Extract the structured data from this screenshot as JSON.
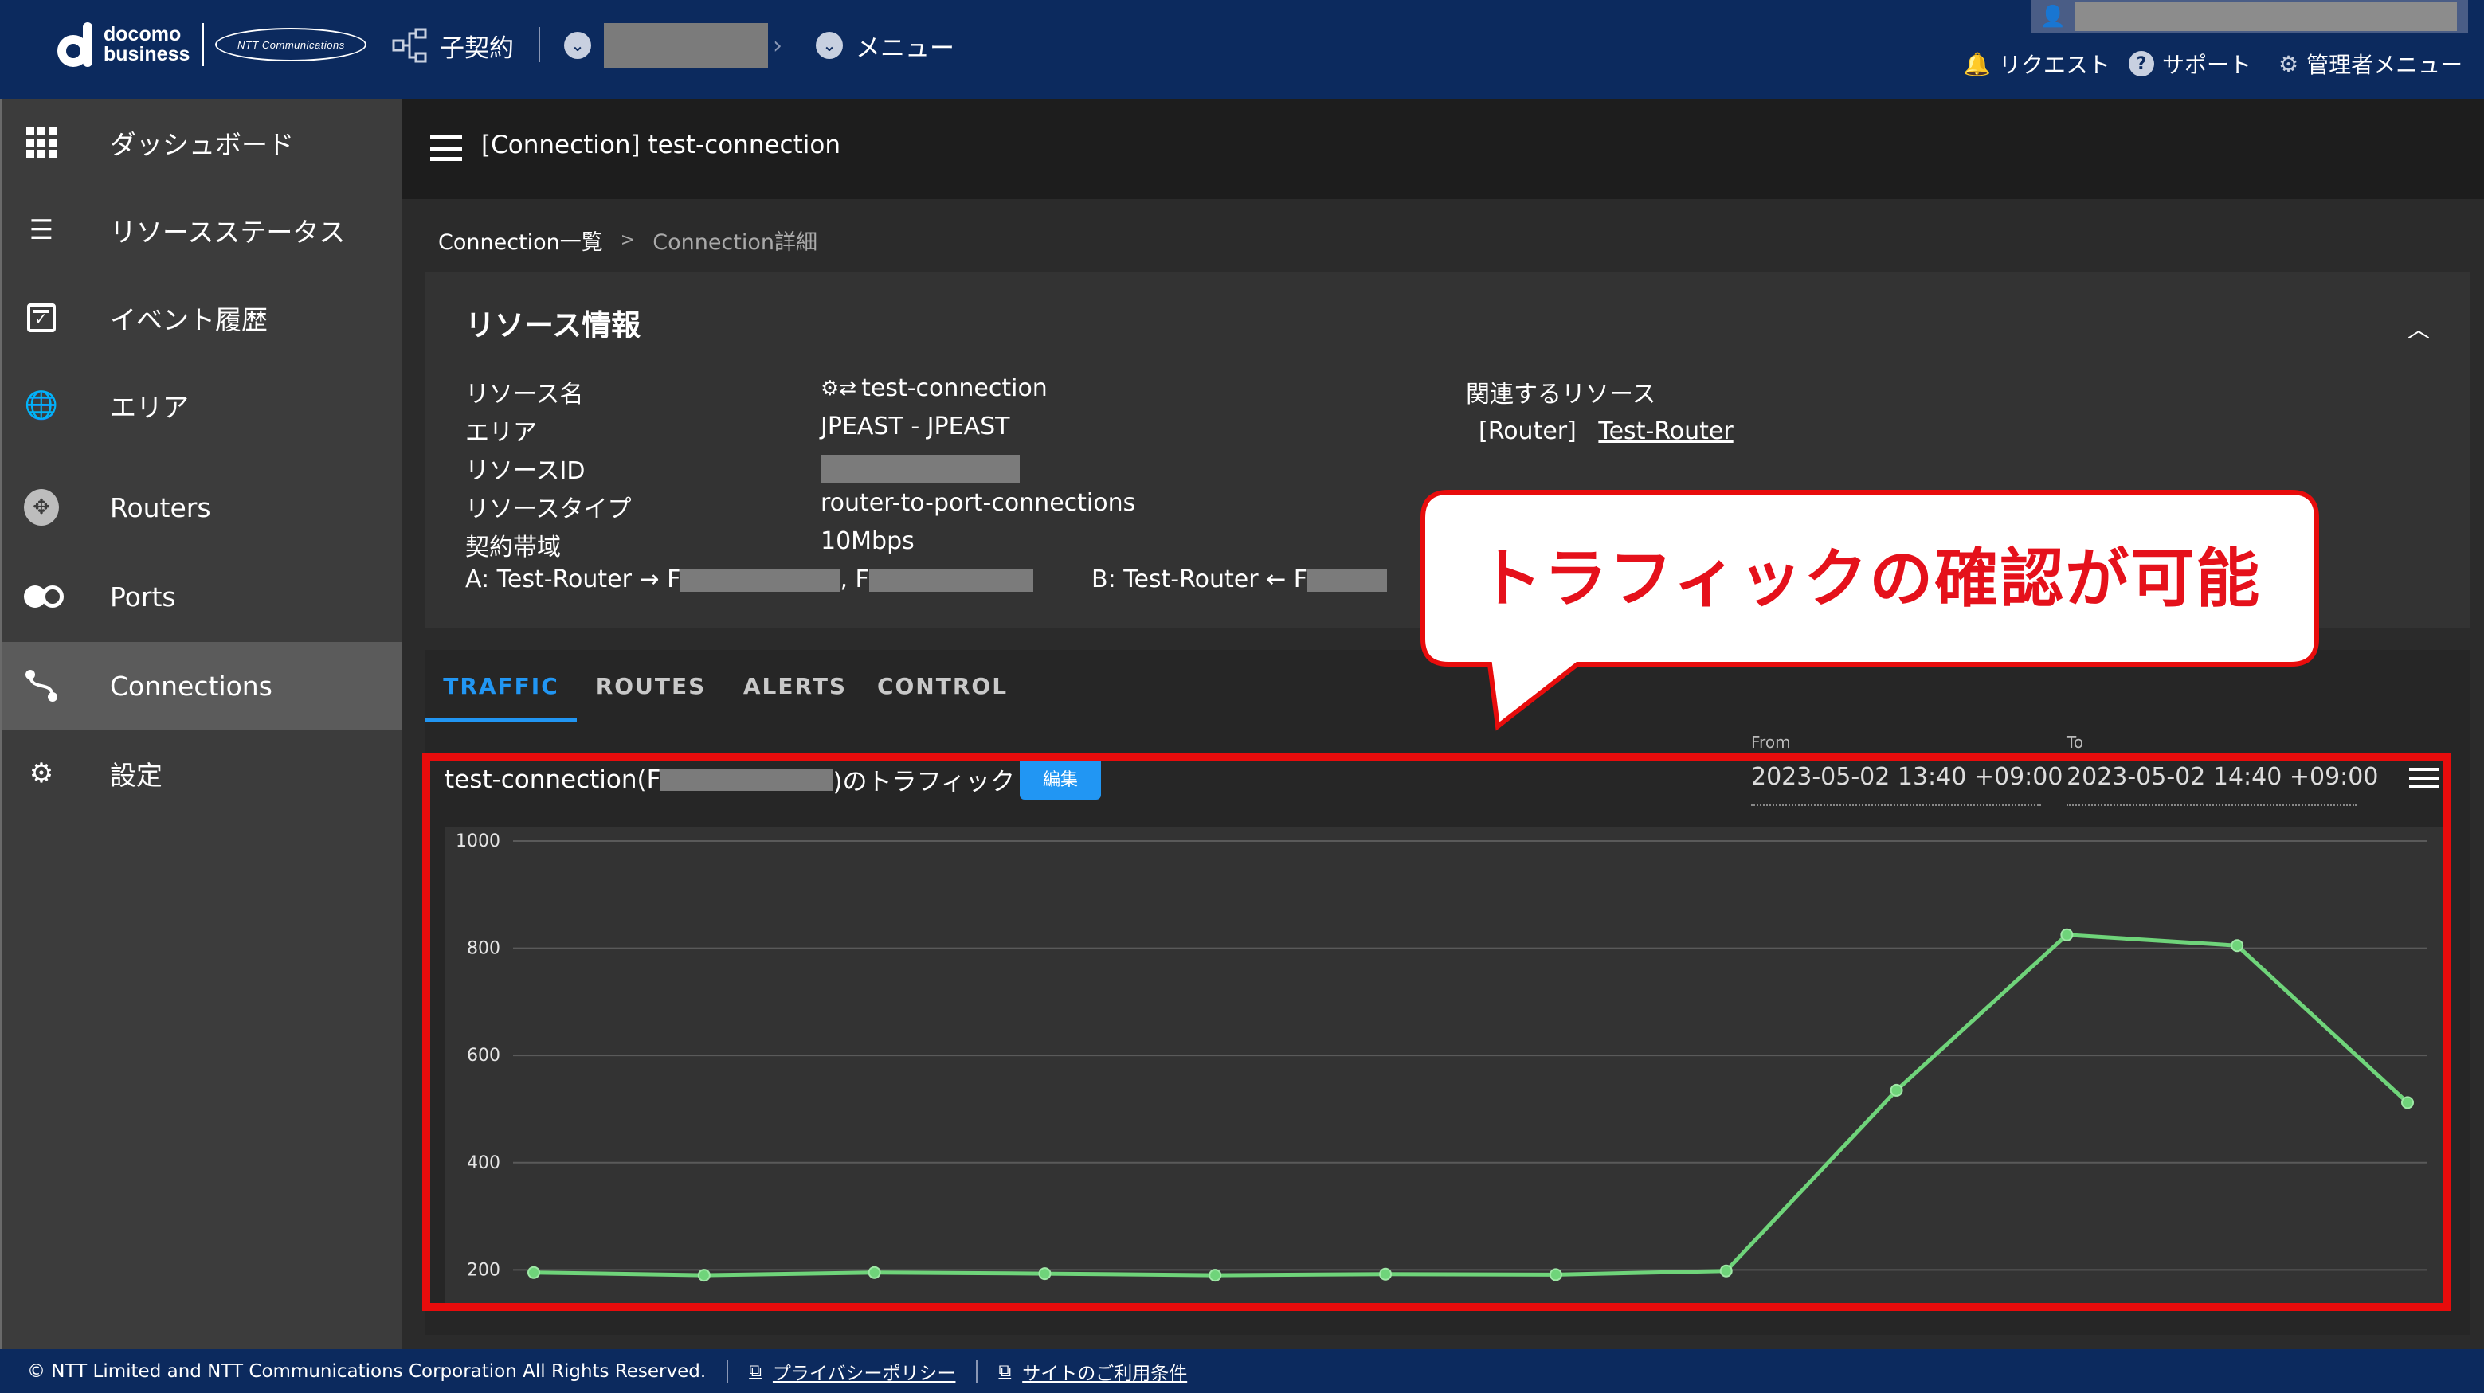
{
  "header": {
    "logo_line1": "docomo",
    "logo_line2": "business",
    "ntt_logo": "NTT Communications",
    "sub_contract": "子契約",
    "menu": "メニュー",
    "nav": {
      "request": "リクエスト",
      "support": "サポート",
      "admin_menu": "管理者メニュー"
    }
  },
  "sidebar": {
    "items": [
      {
        "label": "ダッシュボード",
        "icon": "dashboard-grid-icon"
      },
      {
        "label": "リソースステータス",
        "icon": "resource-status-icon"
      },
      {
        "label": "イベント履歴",
        "icon": "calendar-check-icon"
      },
      {
        "label": "エリア",
        "icon": "globe-icon"
      },
      {
        "label": "Routers",
        "icon": "router-icon"
      },
      {
        "label": "Ports",
        "icon": "ports-icon"
      },
      {
        "label": "Connections",
        "icon": "connection-icon"
      },
      {
        "label": "設定",
        "icon": "gear-icon"
      }
    ]
  },
  "main": {
    "title": "[Connection] test-connection",
    "breadcrumb": {
      "parent": "Connection一覧",
      "separator": ">",
      "current": "Connection詳細"
    },
    "resource_info": {
      "heading": "リソース情報",
      "labels": {
        "name": "リソース名",
        "area": "エリア",
        "id": "リソースID",
        "type": "リソースタイプ",
        "bandwidth": "契約帯域",
        "related": "関連するリソース"
      },
      "values": {
        "name": "test-connection",
        "area": "JPEAST - JPEAST",
        "type": "router-to-port-connections",
        "bandwidth": "10Mbps",
        "related_type": "[Router]",
        "related_name": "Test-Router"
      },
      "endpoints": {
        "a_prefix": "A: Test-Router → F",
        "a_mid": ", F",
        "b_prefix": "B: Test-Router ← F"
      }
    },
    "tabs": [
      "TRAFFIC",
      "ROUTES",
      "ALERTS",
      "CONTROL"
    ],
    "traffic": {
      "title_prefix": "test-connection(F",
      "title_suffix": ")のトラフィック",
      "edit_button": "編集",
      "from_label": "From",
      "from_value": "2023-05-02 13:40 +09:00",
      "to_label": "To",
      "to_value": "2023-05-02 14:40 +09:00"
    }
  },
  "callout": {
    "text": "トラフィックの確認が可能"
  },
  "footer": {
    "copyright": "© NTT Limited and NTT Communications Corporation All Rights Reserved.",
    "privacy": "プライバシーポリシー",
    "terms": "サイトのご利用条件"
  },
  "chart_data": {
    "type": "line",
    "x": [
      1,
      2,
      3,
      4,
      5,
      6,
      7,
      8,
      9,
      10,
      11,
      12
    ],
    "series": [
      {
        "values": [
          195,
          190,
          195,
          193,
          190,
          192,
          191,
          198,
          535,
          825,
          805,
          512
        ]
      }
    ],
    "ylim": [
      150,
      1000
    ],
    "yticks": [
      200,
      400,
      600,
      800,
      1000
    ],
    "grid": true,
    "line_color": "#6fd47a"
  }
}
